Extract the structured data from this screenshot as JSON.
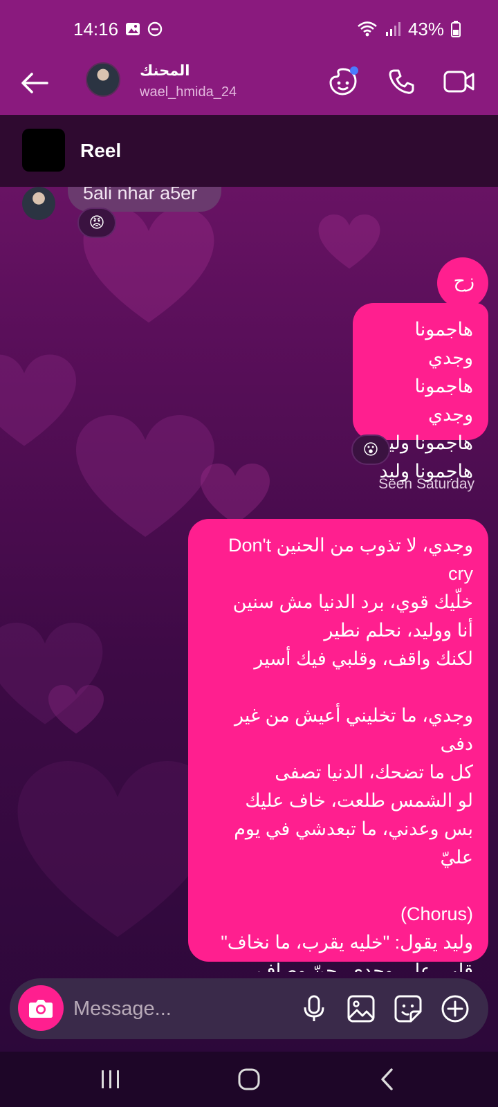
{
  "status_bar": {
    "time": "14:16",
    "battery": "43%"
  },
  "header": {
    "contact_name": "المحنك",
    "contact_handle": "wael_hmida_24"
  },
  "reel": {
    "label": "Reel"
  },
  "messages": {
    "incoming_text": "5ali nhar a5er",
    "incoming_reaction": "😡",
    "short_out": "زح",
    "list_out": [
      "هاجمونا وجدي",
      "هاجمونا وجدي",
      "هاجمونا وليد",
      "هاجمونا وليد"
    ],
    "list_reaction": "😮",
    "seen": "Seen Saturday",
    "lyrics": "وجدي، لا تذوب من الحنين Don't cry\nخلّيك قوي، برد الدنيا مش سنين\nأنا ووليد، نحلم نطير\nلكنك واقف، وقلبي فيك أسير\n\nوجدي، ما تخليني أعيش من غير دفى\nكل ما تضحك، الدنيا تصفى\nلو الشمس طلعت، خاف عليك\nبس وعدني، ما تبعدشي في يوم عليّ\n\n(Chorus)\nوليد يقول: \"خليه يقرب، ما نخاف\"\nقلبي على وجدي، حنّ وصاف\nأنا وياه، نكمل الحكاية\nحتى لو الدنيا تبكي سماها"
  },
  "composer": {
    "placeholder": "Message..."
  },
  "icons": {
    "back": "arrow-left-icon",
    "theme": "theme-face-icon",
    "call": "phone-icon",
    "video": "video-camera-icon",
    "camera": "camera-icon",
    "mic": "microphone-icon",
    "gallery": "image-icon",
    "sticker": "sticker-icon",
    "plus": "plus-circle-icon"
  },
  "colors": {
    "accent": "#ff1f8f",
    "header": "#8a1a7e"
  }
}
